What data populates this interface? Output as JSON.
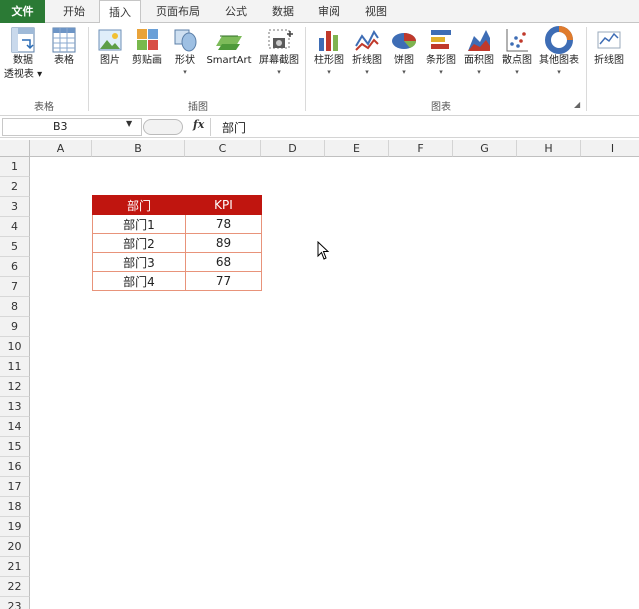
{
  "tabs": [
    {
      "key": "file",
      "label": "文件"
    },
    {
      "key": "home",
      "label": "开始"
    },
    {
      "key": "insert",
      "label": "插入"
    },
    {
      "key": "layout",
      "label": "页面布局"
    },
    {
      "key": "formulas",
      "label": "公式"
    },
    {
      "key": "data",
      "label": "数据"
    },
    {
      "key": "review",
      "label": "审阅"
    },
    {
      "key": "view",
      "label": "视图"
    }
  ],
  "ribbon": {
    "pivot_line1": "数据",
    "pivot_line2": "透视表",
    "table": "表格",
    "picture": "图片",
    "clipart": "剪贴画",
    "shapes": "形状",
    "smartart": "SmartArt",
    "screenshot": "屏幕截图",
    "column_chart": "柱形图",
    "line_chart": "折线图",
    "pie_chart": "饼图",
    "bar_chart": "条形图",
    "area_chart": "面积图",
    "scatter_chart": "散点图",
    "other_chart": "其他图表",
    "sparkline_line": "折线图",
    "group_tables": "表格",
    "group_illustrations": "插图",
    "group_charts": "图表"
  },
  "formula_bar": {
    "cell_ref": "B3",
    "fx": "fx",
    "content": "部门"
  },
  "columns": [
    "A",
    "B",
    "C",
    "D",
    "E",
    "F",
    "G",
    "H",
    "I"
  ],
  "rows": [
    "1",
    "2",
    "3",
    "4",
    "5",
    "6",
    "7",
    "8",
    "9",
    "10",
    "11",
    "12",
    "13",
    "14",
    "15",
    "16",
    "17",
    "18",
    "19",
    "20",
    "21",
    "22",
    "23"
  ],
  "table": {
    "header": [
      "部门",
      "KPI"
    ],
    "rows": [
      [
        "部门1",
        "78"
      ],
      [
        "部门2",
        "89"
      ],
      [
        "部门3",
        "68"
      ],
      [
        "部门4",
        "77"
      ]
    ]
  },
  "colors": {
    "file_tab": "#2b7a35",
    "header_fill": "#c0150f",
    "cell_border": "#e8937a"
  }
}
